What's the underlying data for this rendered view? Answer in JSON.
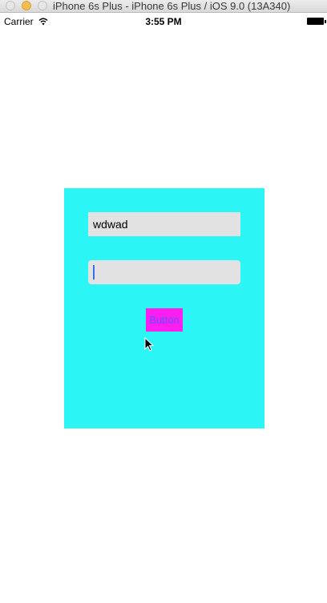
{
  "window": {
    "title": "iPhone 6s Plus - iPhone 6s Plus / iOS 9.0 (13A340)"
  },
  "status_bar": {
    "carrier": "Carrier",
    "time": "3:55 PM",
    "wifi_icon": "wifi-icon",
    "battery_icon": "battery-icon"
  },
  "form": {
    "background_color": "#2cf5f5",
    "field_1": {
      "value": "wdwad"
    },
    "field_2": {
      "value": ""
    },
    "button": {
      "label": "Button",
      "background_color": "#ff1ef0",
      "text_color": "#5a52ff"
    }
  }
}
